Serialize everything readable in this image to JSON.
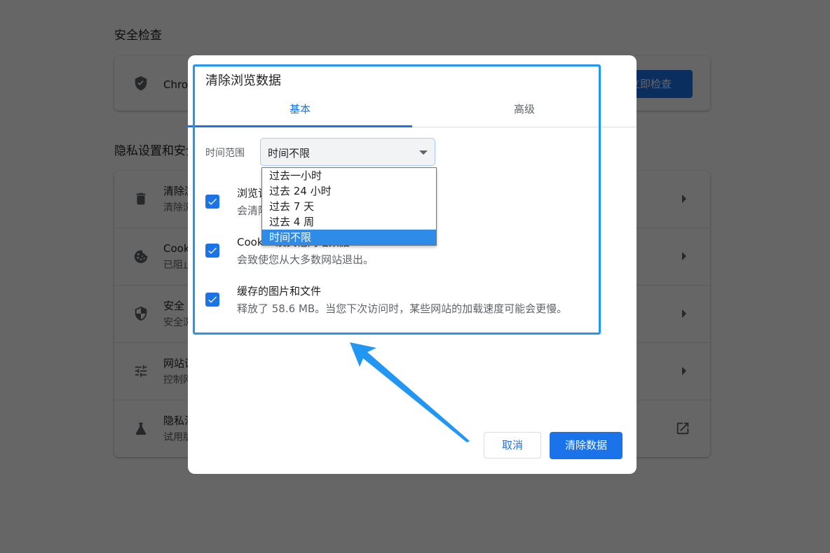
{
  "background": {
    "safety_check": {
      "section_title": "安全检查",
      "row_text": "Chrome 可以帮助保护您免受数据泄露、不良扩展程序等问题的影响",
      "button_label": "立即检查"
    },
    "privacy": {
      "section_title": "隐私设置和安全性",
      "rows": [
        {
          "icon": "trash-icon",
          "title": "清除浏览数据",
          "subtitle": "清除浏览记录、Cookie、缓存及其他数据",
          "trailing": "arrow-right-icon"
        },
        {
          "icon": "cookie-icon",
          "title": "Cookie 及其他网站数据",
          "subtitle": "已阻止无痕模式下的第三方 Cookie",
          "trailing": "arrow-right-icon"
        },
        {
          "icon": "shield-icon",
          "title": "安全",
          "subtitle": "安全浏览（保护您免受危险网站的侵害）和其他安全设置",
          "trailing": "arrow-right-icon"
        },
        {
          "icon": "tune-icon",
          "title": "网站设置",
          "subtitle": "控制网站可以使用和显示什么信息（如位置信息、摄像头、弹出式窗口及其他）",
          "trailing": "arrow-right-icon"
        },
        {
          "icon": "flask-icon",
          "title": "隐私沙盒",
          "subtitle": "试用版功能已开启",
          "trailing": "external-link-icon"
        }
      ]
    }
  },
  "dialog": {
    "title": "清除浏览数据",
    "tabs": [
      {
        "label": "基本",
        "active": true
      },
      {
        "label": "高级",
        "active": false
      }
    ],
    "time_range": {
      "label": "时间范围",
      "value": "时间不限",
      "options": [
        "过去一小时",
        "过去 24 小时",
        "过去 7 天",
        "过去 4 周",
        "时间不限"
      ],
      "selected_index": 4
    },
    "items": [
      {
        "checked": true,
        "title": "浏览记录",
        "subtitle": "会清除已同步设备上的历史记录"
      },
      {
        "checked": true,
        "title": "Cookie 及其他网站数据",
        "subtitle": "会致使您从大多数网站退出。"
      },
      {
        "checked": true,
        "title": "缓存的图片和文件",
        "subtitle": "释放了 58.6 MB。当您下次访问时，某些网站的加载速度可能会更慢。"
      }
    ],
    "cancel_label": "取消",
    "confirm_label": "清除数据"
  },
  "annotation": {
    "color": "#2196f3"
  }
}
